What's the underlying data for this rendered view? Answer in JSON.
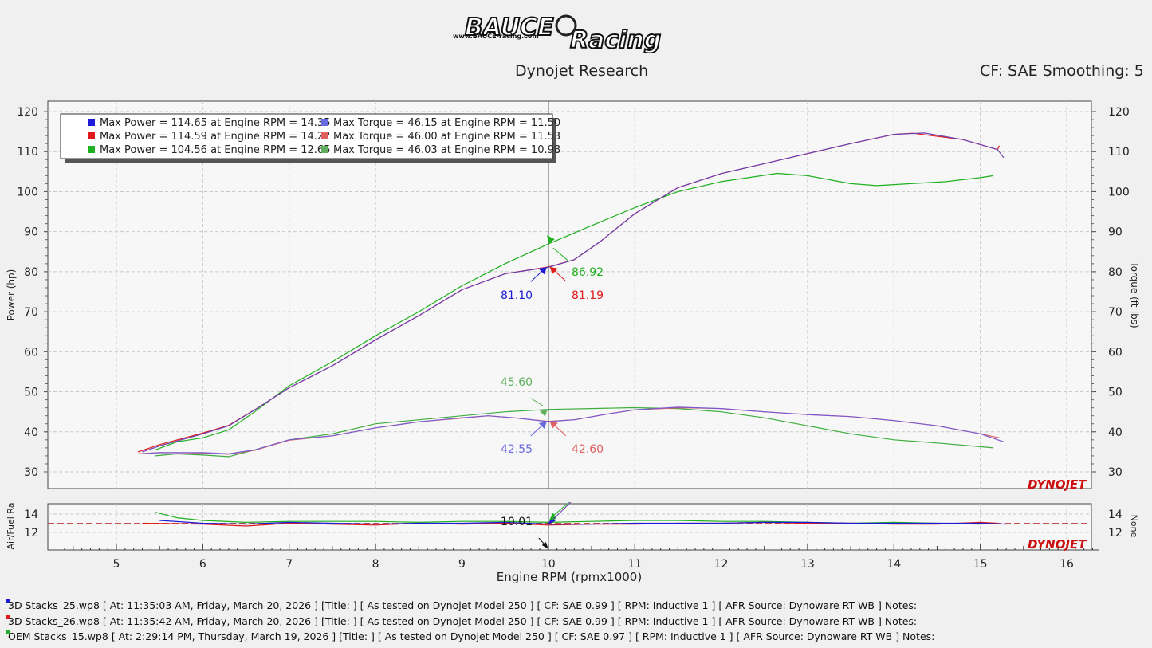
{
  "header": {
    "logo_text": "BAUCE Racing",
    "logo_url_text": "www.BAUCE-racing.com",
    "title": "Dynojet Research",
    "cf_text": "CF: SAE Smoothing: 5",
    "brand_mark": "DYNOJET"
  },
  "colors": {
    "run1": "#1c1cd6",
    "run2": "#e01a1a",
    "run3": "#1fb01f",
    "purple_overlap": "#8040b0",
    "torque1": "#6a5ad8",
    "torque2": "#e06060",
    "torque3": "#60b060",
    "afr_ref": "#c05050"
  },
  "legend": [
    {
      "power": "Max Power = 114.65 at Engine RPM = 14.35",
      "torque": "Max Torque = 46.15 at Engine RPM = 11.50",
      "color": "#1c1cd6",
      "tcolor": "#6a6ae0"
    },
    {
      "power": "Max Power = 114.59 at Engine RPM = 14.22",
      "torque": "Max Torque = 46.00 at Engine RPM = 11.53",
      "color": "#e01a1a",
      "tcolor": "#e06060"
    },
    {
      "power": "Max Power = 104.56 at Engine RPM = 12.65",
      "torque": "Max Torque = 46.03 at Engine RPM = 10.98",
      "color": "#1fb01f",
      "tcolor": "#60b060"
    }
  ],
  "cursor": {
    "rpm": 10.0,
    "power_labels": [
      "81.10",
      "81.19",
      "86.92"
    ],
    "torque_labels": [
      "42.55",
      "42.60",
      "45.60"
    ],
    "afr_label": "10.01"
  },
  "chart_data": [
    {
      "type": "line",
      "title": "Dynojet Research",
      "xlabel": "Engine RPM (rpmx1000)",
      "ylabel": "Power (hp)",
      "y2label": "Torque (ft-lbs)",
      "xlim": [
        4.3,
        16.3
      ],
      "ylim": [
        25,
        123
      ],
      "xticks": [
        5,
        6,
        7,
        8,
        9,
        10,
        11,
        12,
        13,
        14,
        15,
        16
      ],
      "yticks": [
        30,
        40,
        50,
        60,
        70,
        80,
        90,
        100,
        110,
        120
      ],
      "grid": true,
      "legend_position": "top-left",
      "series": [
        {
          "kind": "power",
          "run": 1,
          "color": "#6a3fb5",
          "x": [
            5.3,
            5.5,
            6.0,
            6.3,
            6.6,
            7.0,
            7.5,
            8.0,
            8.5,
            9.0,
            9.5,
            10.0,
            10.3,
            10.6,
            11.0,
            11.5,
            12.0,
            12.5,
            13.0,
            13.5,
            14.0,
            14.35,
            14.8,
            15.2,
            15.27
          ],
          "y": [
            35.0,
            36.5,
            39.5,
            41.5,
            45.5,
            51.0,
            56.5,
            63.0,
            69.0,
            75.5,
            79.5,
            81.1,
            83.0,
            87.5,
            94.5,
            101.0,
            104.5,
            107.0,
            109.5,
            112.0,
            114.3,
            114.65,
            113.0,
            110.5,
            108.5
          ]
        },
        {
          "kind": "power",
          "run": 2,
          "color": "#e01a1a",
          "x": [
            5.25,
            5.5,
            6.0,
            6.3,
            6.6,
            7.0,
            7.5,
            8.0,
            8.5,
            9.0,
            9.5,
            10.0,
            10.3,
            10.6,
            11.0,
            11.5,
            12.0,
            12.5,
            13.0,
            13.5,
            14.0,
            14.22,
            14.8,
            15.2,
            15.22
          ],
          "y": [
            35.0,
            36.8,
            39.7,
            41.6,
            45.5,
            51.0,
            56.5,
            63.0,
            69.0,
            75.5,
            79.5,
            81.19,
            83.0,
            87.5,
            94.5,
            101.0,
            104.5,
            107.0,
            109.5,
            112.0,
            114.3,
            114.59,
            113.0,
            110.5,
            111.5
          ]
        },
        {
          "kind": "power",
          "run": 3,
          "color": "#1fb01f",
          "x": [
            5.45,
            5.7,
            6.0,
            6.3,
            6.6,
            7.0,
            7.5,
            8.0,
            8.5,
            9.0,
            9.5,
            10.0,
            10.5,
            11.0,
            11.5,
            12.0,
            12.65,
            13.0,
            13.5,
            13.8,
            14.2,
            14.6,
            15.0,
            15.15
          ],
          "y": [
            35.5,
            37.5,
            38.5,
            40.5,
            45.0,
            51.5,
            57.5,
            64.0,
            70.0,
            76.5,
            82.0,
            86.92,
            91.5,
            96.0,
            100.0,
            102.5,
            104.56,
            104.0,
            102.0,
            101.5,
            102.0,
            102.5,
            103.5,
            104.0
          ]
        },
        {
          "kind": "torque",
          "run": 1,
          "color": "#7a5ad0",
          "x": [
            5.3,
            5.5,
            6.0,
            6.3,
            6.6,
            7.0,
            7.5,
            8.0,
            8.5,
            9.0,
            9.3,
            9.6,
            10.0,
            10.3,
            10.7,
            11.0,
            11.5,
            12.0,
            12.5,
            13.0,
            13.5,
            14.0,
            14.5,
            15.0,
            15.27
          ],
          "y": [
            34.5,
            34.8,
            34.8,
            34.5,
            35.5,
            38.0,
            39.0,
            41.0,
            42.5,
            43.5,
            44.0,
            43.5,
            42.55,
            43.0,
            44.5,
            45.5,
            46.15,
            45.8,
            45.0,
            44.3,
            43.8,
            42.8,
            41.5,
            39.5,
            37.5
          ]
        },
        {
          "kind": "torque",
          "run": 2,
          "color": "#e06060",
          "x": [
            5.25,
            5.5,
            6.0,
            6.3,
            6.6,
            7.0,
            7.5,
            8.0,
            8.5,
            9.0,
            9.3,
            9.6,
            10.0,
            10.3,
            10.7,
            11.0,
            11.53,
            12.0,
            12.5,
            13.0,
            13.5,
            14.0,
            14.5,
            15.0,
            15.22
          ],
          "y": [
            34.5,
            34.8,
            34.7,
            34.4,
            35.4,
            37.9,
            39.0,
            41.0,
            42.5,
            43.4,
            44.0,
            43.5,
            42.6,
            43.0,
            44.5,
            45.5,
            46.0,
            45.8,
            45.0,
            44.3,
            43.8,
            42.8,
            41.5,
            39.5,
            38.5
          ]
        },
        {
          "kind": "torque",
          "run": 3,
          "color": "#3cae3c",
          "x": [
            5.45,
            5.7,
            6.0,
            6.3,
            6.6,
            7.0,
            7.5,
            8.0,
            8.5,
            9.0,
            9.5,
            10.0,
            10.5,
            10.98,
            11.5,
            12.0,
            12.5,
            13.0,
            13.5,
            14.0,
            14.5,
            15.0,
            15.15
          ],
          "y": [
            34.0,
            34.5,
            34.2,
            33.8,
            35.5,
            38.0,
            39.5,
            42.0,
            43.0,
            44.0,
            45.0,
            45.6,
            45.8,
            46.03,
            45.8,
            45.0,
            43.5,
            41.5,
            39.5,
            38.0,
            37.2,
            36.3,
            36.0
          ]
        }
      ]
    },
    {
      "type": "line",
      "title": "",
      "ylabel": "Air/Fuel Ra",
      "y2label": "None",
      "xlim": [
        4.3,
        16.3
      ],
      "ylim": [
        10,
        15.5
      ],
      "yticks": [
        12,
        14
      ],
      "reference_line": 13.0,
      "series": [
        {
          "run": 1,
          "color": "#1c1cd6",
          "x": [
            5.5,
            6.0,
            6.5,
            7.0,
            7.5,
            8.0,
            8.5,
            9.0,
            9.5,
            10.0,
            10.5,
            11.0,
            11.5,
            12.0,
            12.5,
            13.0,
            13.5,
            14.0,
            14.5,
            15.0,
            15.3
          ],
          "y": [
            13.3,
            13.0,
            12.9,
            13.1,
            13.0,
            12.9,
            13.0,
            13.0,
            13.1,
            12.9,
            12.9,
            13.0,
            13.0,
            13.0,
            13.1,
            13.1,
            13.0,
            13.0,
            13.0,
            13.0,
            12.9
          ]
        },
        {
          "run": 2,
          "color": "#e01a1a",
          "x": [
            5.3,
            6.0,
            6.5,
            7.0,
            7.5,
            8.0,
            8.5,
            9.0,
            9.5,
            10.0,
            10.5,
            11.0,
            11.5,
            12.0,
            12.5,
            13.0,
            13.5,
            14.0,
            14.5,
            15.0,
            15.2
          ],
          "y": [
            13.0,
            12.9,
            12.7,
            13.0,
            12.9,
            12.8,
            13.0,
            12.9,
            13.0,
            12.8,
            12.9,
            12.9,
            13.0,
            13.0,
            13.1,
            13.0,
            13.0,
            12.9,
            12.9,
            13.1,
            13.0
          ]
        },
        {
          "run": 3,
          "color": "#1fb01f",
          "x": [
            5.45,
            5.7,
            6.0,
            6.5,
            7.0,
            7.5,
            8.0,
            8.5,
            9.0,
            9.5,
            10.0,
            10.5,
            11.0,
            11.5,
            12.0,
            12.5,
            13.0,
            13.5,
            14.0,
            14.5,
            15.0,
            15.15
          ],
          "y": [
            14.2,
            13.6,
            13.3,
            13.1,
            13.2,
            13.2,
            13.2,
            13.1,
            13.2,
            13.2,
            13.1,
            13.2,
            13.3,
            13.3,
            13.2,
            13.2,
            13.1,
            13.0,
            13.1,
            13.0,
            12.9,
            13.0
          ]
        }
      ]
    }
  ],
  "footer": {
    "runs": [
      {
        "text": "3D Stacks_25.wp8 [ At: 11:35:03 AM, Friday, March 20, 2026 ] [Title: ]  [ As tested on Dynojet Model 250 ] [ CF: SAE 0.99 ] [ RPM: Inductive 1 ] [ AFR Source: Dynoware RT WB ] Notes:",
        "color": "#1c1cd6"
      },
      {
        "text": "3D Stacks_26.wp8 [ At: 11:35:42 AM, Friday, March 20, 2026 ] [Title: ]  [ As tested on Dynojet Model 250 ] [ CF: SAE 0.99 ] [ RPM: Inductive 1 ] [ AFR Source: Dynoware RT WB ] Notes:",
        "color": "#e01a1a"
      },
      {
        "text": "OEM Stacks_15.wp8 [ At: 2:29:14 PM, Thursday, March 19, 2026 ] [Title: ]  [ As tested on Dynojet Model 250 ] [ CF: SAE 0.97 ] [ RPM: Inductive 1 ] [ AFR Source: Dynoware RT WB ] Notes:",
        "color": "#1fb01f"
      }
    ]
  }
}
